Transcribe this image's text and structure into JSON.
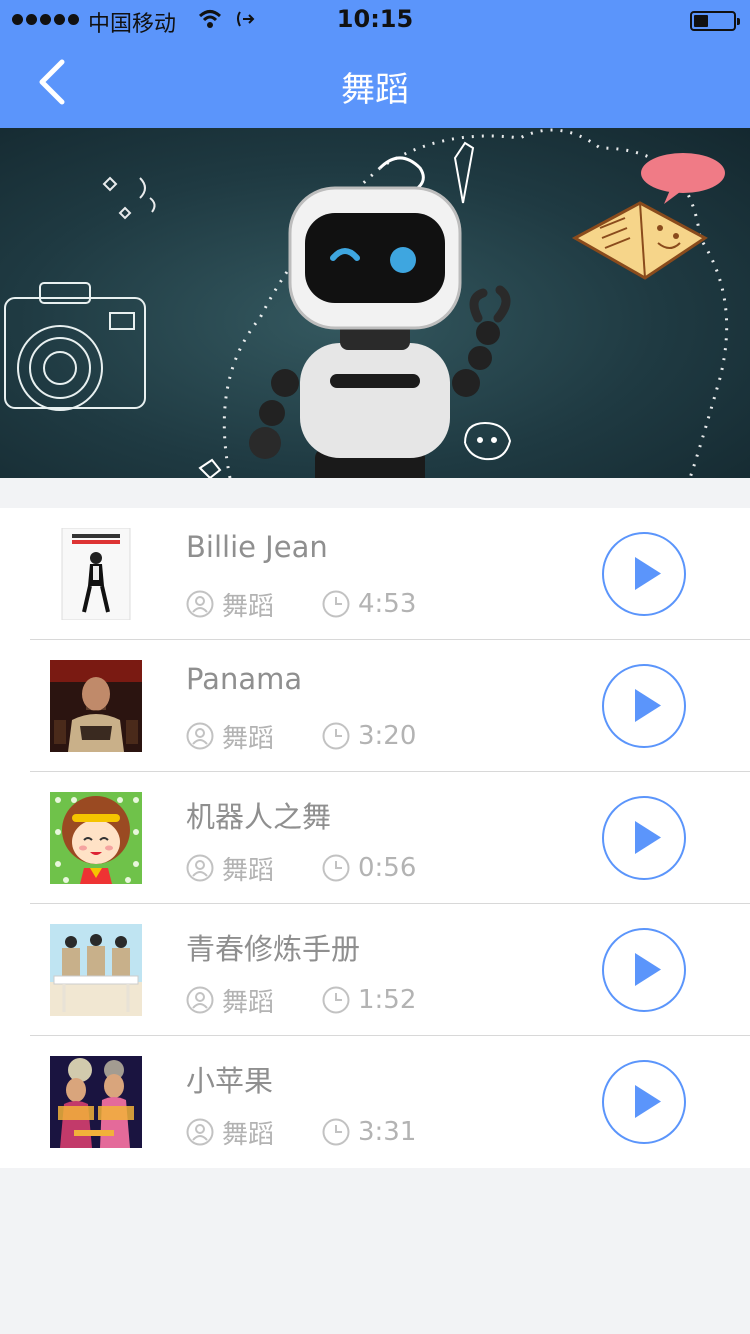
{
  "status_bar": {
    "carrier": "中国移动",
    "time": "10:15"
  },
  "nav": {
    "title": "舞蹈",
    "back_icon": "chevron-left-icon"
  },
  "colors": {
    "accent": "#5b95fb",
    "banner_bg": "#1f3a42",
    "text_title": "#8f8f8f",
    "text_meta": "#b3b3b3"
  },
  "songs": [
    {
      "title": "Billie Jean",
      "category": "舞蹈",
      "duration": "4:53"
    },
    {
      "title": "Panama",
      "category": "舞蹈",
      "duration": "3:20"
    },
    {
      "title": "机器人之舞",
      "category": "舞蹈",
      "duration": "0:56"
    },
    {
      "title": "青春修炼手册",
      "category": "舞蹈",
      "duration": "1:52"
    },
    {
      "title": "小苹果",
      "category": "舞蹈",
      "duration": "3:31"
    }
  ]
}
